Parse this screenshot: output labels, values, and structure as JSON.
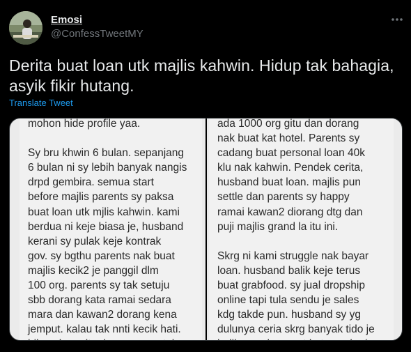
{
  "user": {
    "display_name": "Emosi",
    "handle": "@ConfessTweetMY",
    "avatar_icon": "user-avatar-photo"
  },
  "more_icon": "more-horizontal-icon",
  "tweet": {
    "text": "Derita buat loan utk majlis kahwin. Hidup tak bahagia, asyik fikir hutang.",
    "translate_label": "Translate Tweet"
  },
  "media": {
    "left_panel_text": "mohon hide profile yaa.\n\nSy bru khwin 6 bulan. sepanjang\n6 bulan ni sy lebih banyak nangis\ndrpd gembira. semua start\nbefore majlis parents sy paksa\nbuat loan utk mjlis kahwin. kami\nberdua ni keje biasa je, husband\nkerani sy pulak keje kontrak\ngov. sy bgthu parents nak buat\nmajlis kecik2 je panggil dlm\n100 org. parents sy tak setuju\nsbb dorang kata ramai sedara\nmara dan kawan2 dorang kena\njemput. kalau tak nnti kecik hati.\nbila cakap gitu dorang mcm tak",
    "right_panel_text": "ada 1000 org gitu dan dorang\nnak buat kat hotel. Parents sy\ncadang buat personal loan 40k\nklu nak kahwin. Pendek cerita,\nhusband buat loan. majlis pun\nsettle dan parents sy happy\nramai kawan2 diorang dtg dan\npuji majlis grand la itu ini.\n\nSkrg ni kami struggle nak bayar\nloan. husband balik keje terus\nbuat grabfood. sy jual dropship\nonline tapi tula sendu je sales\nkdg takde pun. husband sy yg\ndulunya ceria skrg banyak tido je\nbalik rumah. penat katanya kerja"
  },
  "colors": {
    "background": "#000000",
    "primary_text": "#e7e9ea",
    "secondary_text": "#71767b",
    "link": "#1d9bf0"
  }
}
